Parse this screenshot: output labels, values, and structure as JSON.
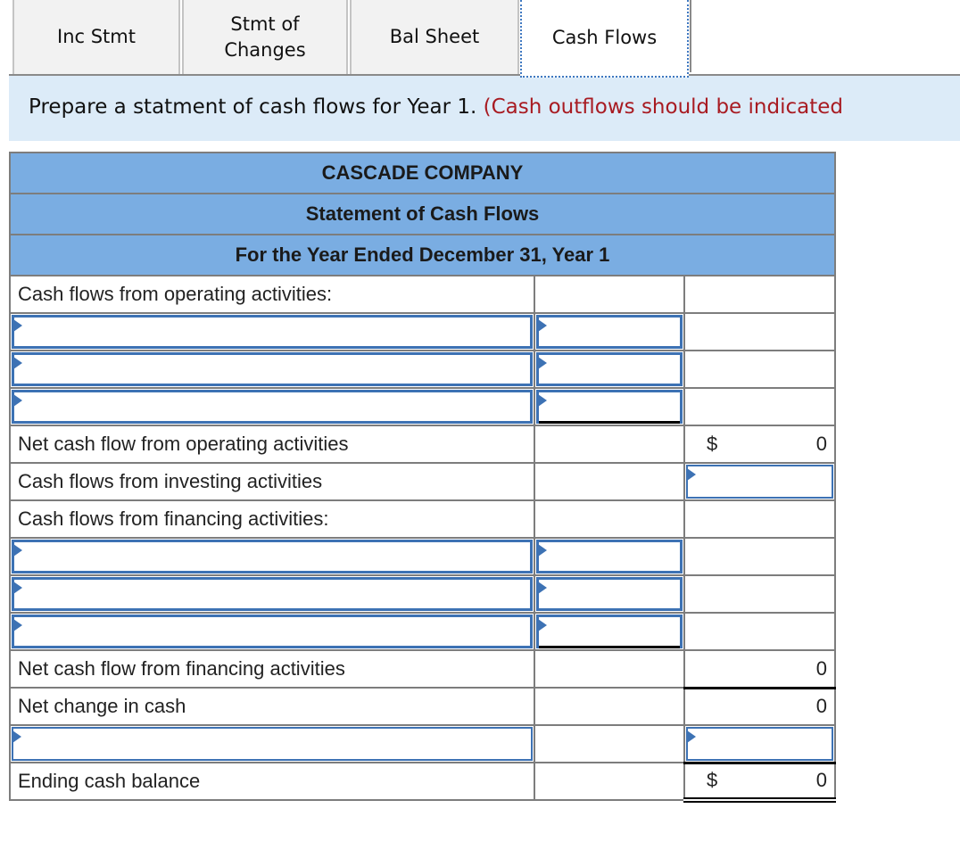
{
  "tabs": [
    {
      "label": "Inc Stmt",
      "active": false
    },
    {
      "label": "Stmt of\nChanges",
      "active": false
    },
    {
      "label": "Bal Sheet",
      "active": false
    },
    {
      "label": "Cash Flows",
      "active": true
    }
  ],
  "instruction": {
    "text": "Prepare a statment of cash flows for Year 1. ",
    "note": "(Cash outflows should be indicated"
  },
  "statement": {
    "company": "CASCADE COMPANY",
    "title": "Statement of Cash Flows",
    "period": "For the Year Ended December 31, Year 1",
    "rows": {
      "operating_header": "Cash flows from operating activities:",
      "net_operating_label": "Net cash flow from operating activities",
      "net_operating_currency": "$",
      "net_operating_value": "0",
      "investing_label": "Cash flows from investing activities",
      "financing_header": "Cash flows from financing activities:",
      "net_financing_label": "Net cash flow from financing activities",
      "net_financing_value": "0",
      "net_change_label": "Net change in cash",
      "net_change_value": "0",
      "ending_label": "Ending cash balance",
      "ending_currency": "$",
      "ending_value": "0"
    },
    "operating_inputs": [
      {
        "label": "",
        "amount": ""
      },
      {
        "label": "",
        "amount": ""
      },
      {
        "label": "",
        "amount": ""
      }
    ],
    "investing_input": {
      "amount": ""
    },
    "financing_inputs": [
      {
        "label": "",
        "amount": ""
      },
      {
        "label": "",
        "amount": ""
      },
      {
        "label": "",
        "amount": ""
      }
    ],
    "beginning_input": {
      "label": "",
      "amount": ""
    }
  },
  "colors": {
    "header_fill": "#7aade2",
    "input_border": "#3d72b4",
    "instruction_bg": "#dcebf8",
    "note_red": "#a81b22"
  }
}
